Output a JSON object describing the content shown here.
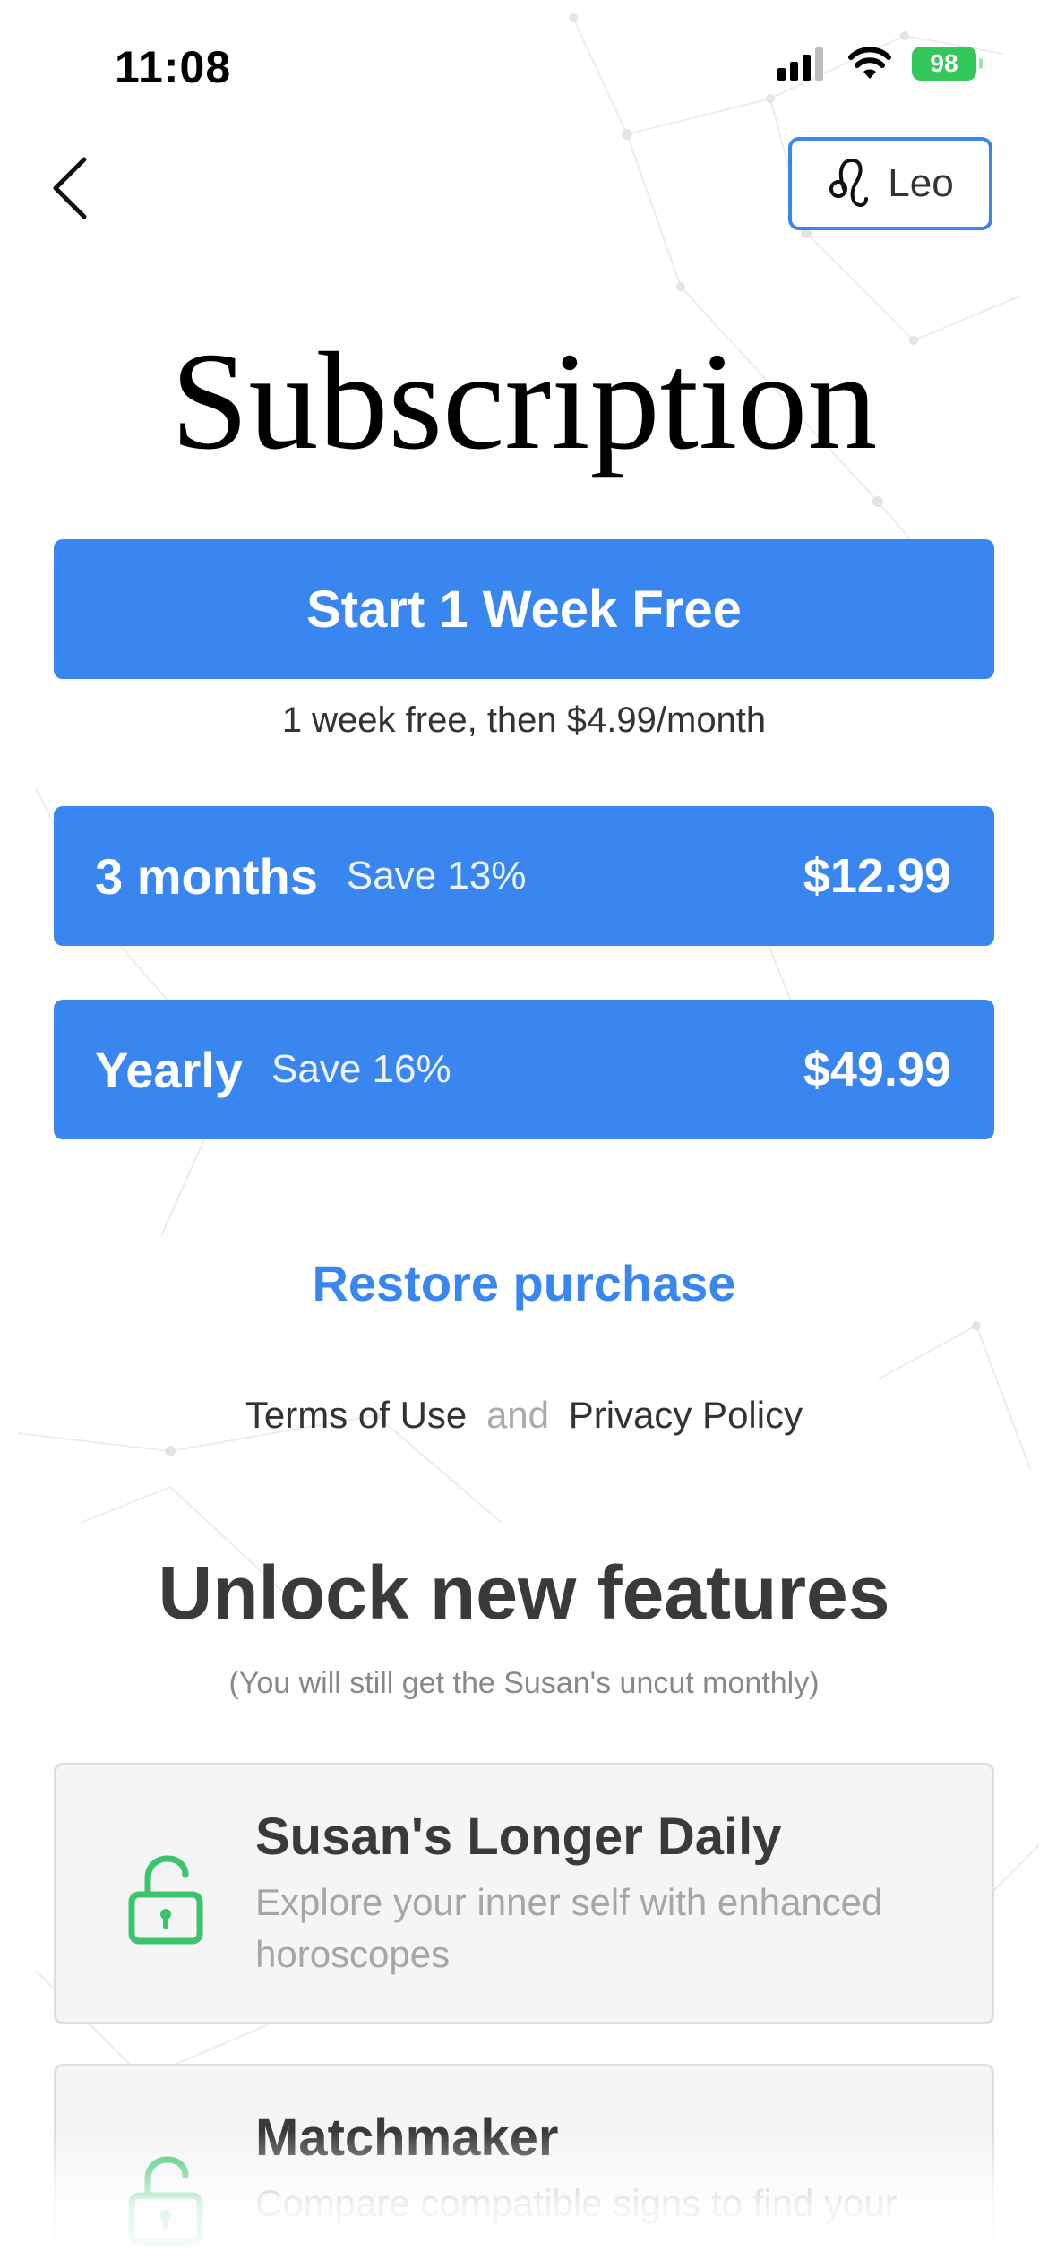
{
  "status_bar": {
    "time": "11:08",
    "battery": "98"
  },
  "nav": {
    "back_icon": "chevron-left-icon",
    "sign_icon": "leo-zodiac-icon",
    "sign_label": "Leo"
  },
  "title": "Subscription",
  "trial": {
    "button_label": "Start 1 Week Free",
    "note": "1 week free, then $4.99/month"
  },
  "plans": [
    {
      "name": "3 months",
      "save": "Save 13%",
      "price": "$12.99"
    },
    {
      "name": "Yearly",
      "save": "Save 16%",
      "price": "$49.99"
    }
  ],
  "restore_label": "Restore purchase",
  "legal": {
    "terms": "Terms of Use",
    "and": "and",
    "privacy": "Privacy Policy"
  },
  "features": {
    "title": "Unlock new features",
    "subtitle": "(You will still get the Susan's uncut monthly)",
    "items": [
      {
        "icon": "unlocked-padlock-icon",
        "title": "Susan's Longer Daily",
        "description": "Explore your inner self with enhanced horoscopes"
      },
      {
        "icon": "unlocked-padlock-icon",
        "title": "Matchmaker",
        "description": "Compare compatible signs to find your"
      }
    ]
  },
  "colors": {
    "accent": "#3a86f0",
    "lock_green": "#3cc46a",
    "battery_green": "#34c759"
  }
}
